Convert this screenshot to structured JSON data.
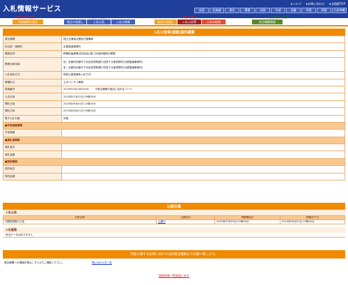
{
  "header": {
    "title": "入札情報サービス",
    "links": [
      "★ヘルプ",
      "★お問い合わせ",
      "★全国版TOP"
    ],
    "regions": [
      "全国",
      "北海道",
      "東北",
      "関東",
      "北陸",
      "中部",
      "近畿",
      "中国",
      "四国",
      "九州沖縄"
    ]
  },
  "categories": {
    "headers": [
      "中部縦断の検索",
      "工事の検索",
      "業務の検索",
      "発注機関で検索"
    ],
    "tabs": [
      "中部縦断の発注",
      "発注の見通し",
      "入札公告",
      "入札の結果",
      "発注の見通し",
      "入札公告等",
      "入札の結果",
      "発注機関情報"
    ]
  },
  "detail": {
    "title": "入札公告等(業務)案件概要",
    "rows": [
      {
        "label": "発注機関",
        "value": "国土交通省近畿地方整備局"
      },
      {
        "label": "担当部・事務所",
        "value": "京都国道事務所"
      },
      {
        "label": "業務名称",
        "value": "精華拡幅事業(田辺地区)施工計画詳細設計業務"
      },
      {
        "label": "業務対象地域",
        "value": "自：京都府京都市下京区西洞院通り四条下る東洞院町(京都国道事務所)\n至：京都府京都市下京区西洞院通り四条下る東洞院町(京都国道事務所)"
      },
      {
        "label": "入札契約方式",
        "value": "簡易公募型競争入札方式"
      },
      {
        "label": "業種区分",
        "value": "土木コンサル業務"
      },
      {
        "label": "調達番号",
        "value": "2023901823940016        ※発注機関が独自に定めるコード"
      },
      {
        "label": "公告日時",
        "value": "2025年07月25日 09時00分"
      },
      {
        "label": "開札日時",
        "value": "2025年09月01日 12時00分"
      },
      {
        "label": "開札日時",
        "value": "2025年09月21日 09時30分"
      },
      {
        "label": "電子入札対象",
        "value": "対象"
      }
    ],
    "sections": {
      "price": "■予定価格情報",
      "winner": "■落札者情報",
      "contract": "■契約情報"
    },
    "price_rows": [
      {
        "label": "予定価格",
        "value": ""
      }
    ],
    "winner_rows": [
      {
        "label": "落札者名",
        "value": ""
      },
      {
        "label": "落札金額",
        "value": ""
      }
    ],
    "contract_rows": [
      {
        "label": "契約者名",
        "value": ""
      },
      {
        "label": "契約金額",
        "value": ""
      }
    ]
  },
  "documents": {
    "title": "公開文書",
    "subhead": "入札公告",
    "columns": [
      "文書名称",
      "公開状況",
      "掲載開始日",
      "掲載終了日"
    ],
    "rows": [
      {
        "name": "※閲覧制限の公告",
        "status": "公開中",
        "start": "2025年07月25日 07時00分",
        "end": "2025年09月01日 23時00分"
      }
    ]
  },
  "results": {
    "subhead": "入札経過",
    "empty": "該当データはありません"
  },
  "contact": {
    "banner": "内容に関するお問い合わせは各発注機関までお願い致します。",
    "message": "発注機関への連絡先等はこちらからご確認ください。",
    "link": "問い合わせ先一覧"
  },
  "back_link": "検索結果一覧画面に戻る"
}
